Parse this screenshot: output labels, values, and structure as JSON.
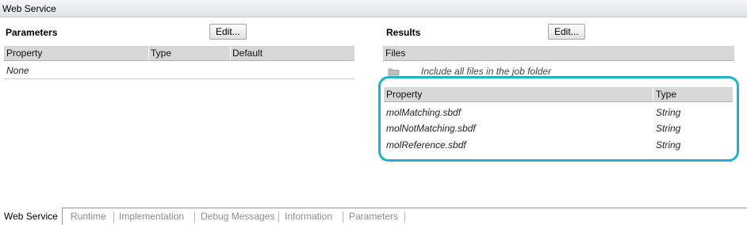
{
  "window": {
    "title": "Web Service"
  },
  "parameters": {
    "title": "Parameters",
    "edit_label": "Edit...",
    "columns": [
      "Property",
      "Type",
      "Default"
    ],
    "rows": [
      "None"
    ]
  },
  "results": {
    "title": "Results",
    "edit_label": "Edit...",
    "files_header": "Files",
    "include_text": "Include all files in the job folder",
    "columns": [
      "Property",
      "Type"
    ],
    "rows": [
      {
        "property": "molMatching.sbdf",
        "type": "String"
      },
      {
        "property": "molNotMatching.sbdf",
        "type": "String"
      },
      {
        "property": "molReference.sbdf",
        "type": "String"
      }
    ]
  },
  "tabs": [
    "Web Service",
    "Runtime",
    "Implementation",
    "Debug Messages",
    "Information",
    "Parameters"
  ],
  "colors": {
    "highlight": "#1fb3c8",
    "header_bg": "#d7d7d7"
  },
  "icons": {
    "include": "folder-icon"
  }
}
